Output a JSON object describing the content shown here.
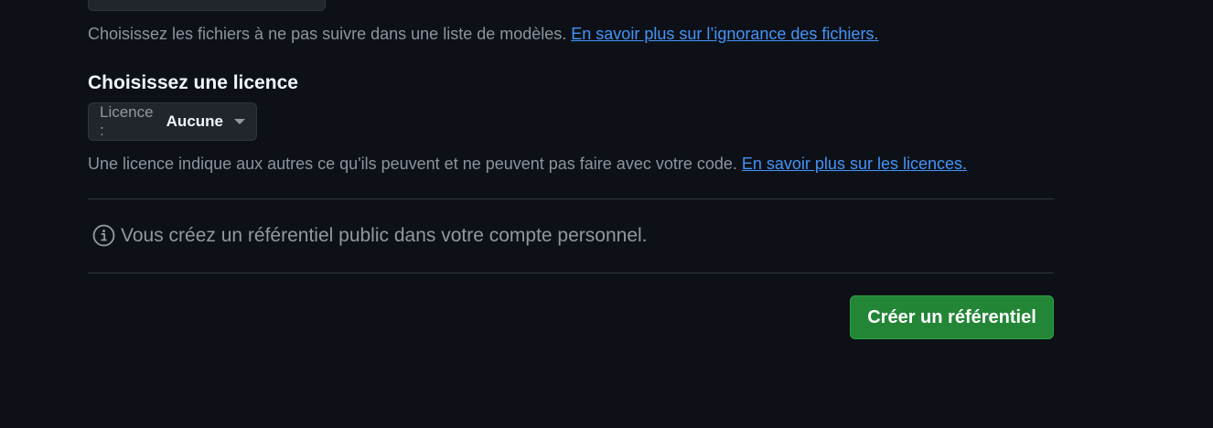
{
  "gitignore": {
    "help_text": "Choisissez les fichiers à ne pas suivre dans une liste de modèles. ",
    "help_link": "En savoir plus sur l’ignorance des fichiers."
  },
  "license": {
    "heading": "Choisissez une licence",
    "select_prefix": "Licence :",
    "select_value": "Aucune",
    "help_text": "Une licence indique aux autres ce qu'ils peuvent et ne peuvent pas faire avec votre code. ",
    "help_link": "En savoir plus sur les licences."
  },
  "notice": {
    "icon": "info-icon",
    "text": "Vous créez un référentiel public dans votre compte personnel."
  },
  "actions": {
    "create_label": "Créer un référentiel"
  },
  "colors": {
    "background": "#0d1117",
    "link": "#4493f8",
    "primary_button": "#238636"
  }
}
